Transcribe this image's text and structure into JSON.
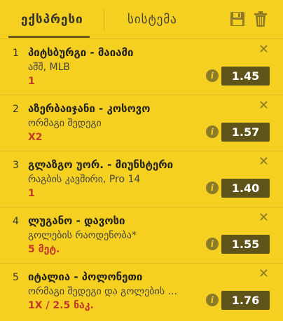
{
  "tabs": [
    {
      "label": "ექსპრესი",
      "active": true
    },
    {
      "label": "სისტემა",
      "active": false
    }
  ],
  "icons": {
    "save": "floppy-disk-icon",
    "delete": "trash-icon",
    "info": "info-icon",
    "close": "close-icon"
  },
  "colors": {
    "background": "#f5d020",
    "odds_button": "#5e5318",
    "pick_text": "#c0392b",
    "icon": "#8a7a2a"
  },
  "bets": [
    {
      "num": "1",
      "match": "პიტსბურგი - მაიამი",
      "league": "აშშ, MLB",
      "pick": "1",
      "odds": "1.45"
    },
    {
      "num": "2",
      "match": "აზერბაიჯანი - კოსოვო",
      "league": "ორმაგი შედეგი",
      "pick": "X2",
      "odds": "1.57"
    },
    {
      "num": "3",
      "match": "გლაზგო უორ. - მიუნსტერი",
      "league": "რაგბის კავშირი, Pro 14",
      "pick": "1",
      "odds": "1.40"
    },
    {
      "num": "4",
      "match": "ლუგანო - დავოსი",
      "league": "გოლების რაოდენობა*",
      "pick": "5 მეტ.",
      "odds": "1.55"
    },
    {
      "num": "5",
      "match": "იტალია - პოლონეთი",
      "league": "ორმაგი შედეგი და გოლების ...",
      "pick": "1X / 2.5 ნაკ.",
      "odds": "1.76"
    }
  ]
}
